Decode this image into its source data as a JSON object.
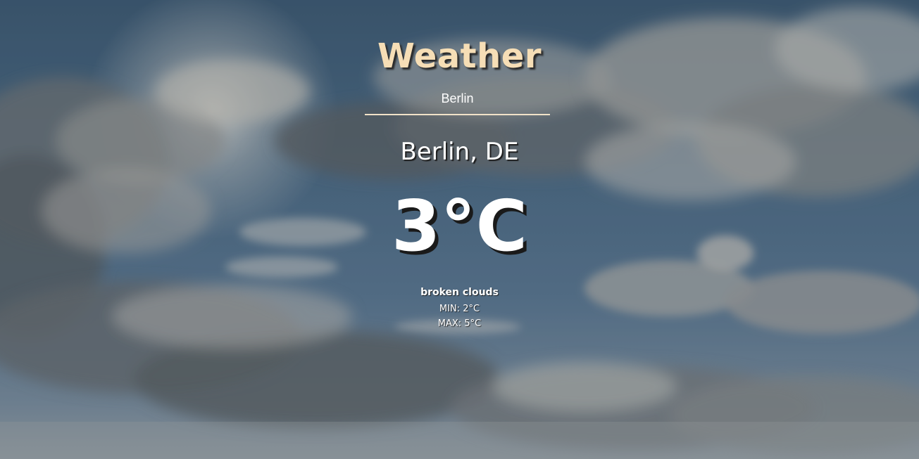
{
  "app": {
    "title": "Weather"
  },
  "search": {
    "value": "Berlin",
    "placeholder": "Berlin"
  },
  "weather": {
    "location": "Berlin, DE",
    "temperature": "3°C",
    "description": "broken clouds",
    "min": "MIN: 2°C",
    "max": "MAX: 5°C"
  },
  "background": {
    "image": "cloudy-sky-photo",
    "colors": {
      "sky": "#4c6a85",
      "title": "#f6deb6",
      "text": "#ffffff"
    }
  }
}
